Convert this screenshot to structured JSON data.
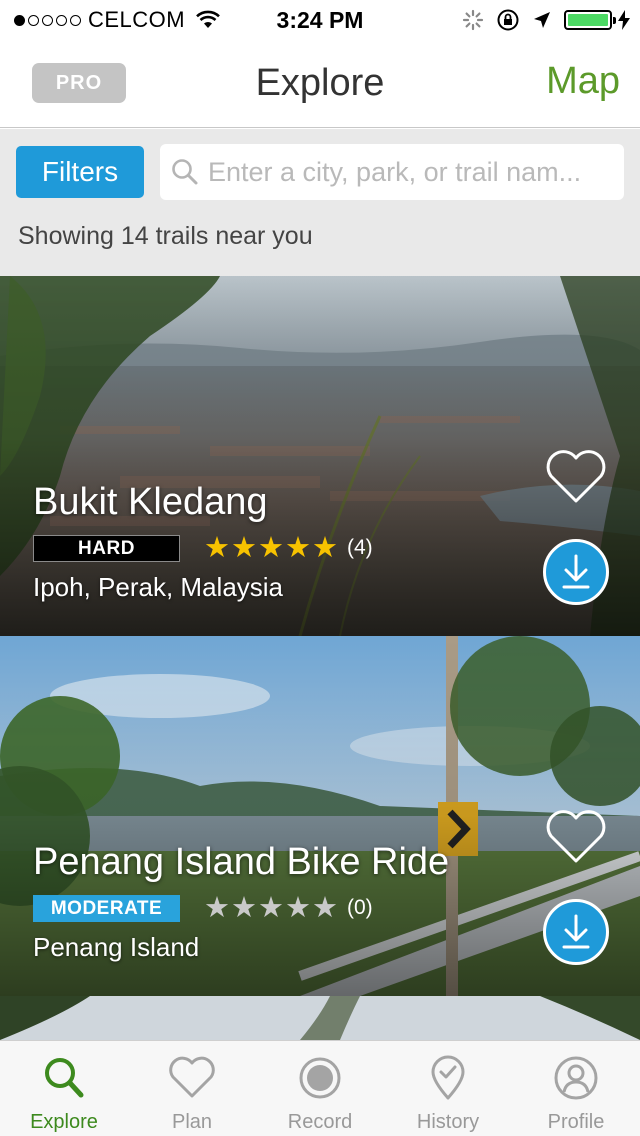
{
  "status_bar": {
    "carrier": "CELCOM",
    "time": "3:24 PM",
    "signal_bars_filled": 1,
    "signal_bars_total": 5,
    "battery_level": 1.0
  },
  "header": {
    "pro_label": "PRO",
    "title": "Explore",
    "map_label": "Map"
  },
  "search": {
    "filters_label": "Filters",
    "placeholder": "Enter a city, park, or trail nam...",
    "value": "",
    "result_count": "Showing 14 trails near you"
  },
  "trails": [
    {
      "name": "Bukit Kledang",
      "difficulty": "HARD",
      "rating": 5,
      "rating_max": 5,
      "reviews": "(4)",
      "location": "Ipoh, Perak, Malaysia"
    },
    {
      "name": "Penang Island Bike Ride",
      "difficulty": "MODERATE",
      "rating": 0,
      "rating_max": 5,
      "reviews": "(0)",
      "location": "Penang Island"
    }
  ],
  "tabs": [
    {
      "label": "Explore",
      "icon": "search-icon",
      "active": true
    },
    {
      "label": "Plan",
      "icon": "heart-icon",
      "active": false
    },
    {
      "label": "Record",
      "icon": "record-icon",
      "active": false
    },
    {
      "label": "History",
      "icon": "location-check-icon",
      "active": false
    },
    {
      "label": "Profile",
      "icon": "profile-icon",
      "active": false
    }
  ],
  "colors": {
    "accent_blue": "#1f9ad9",
    "brand_green": "#5c9a2a",
    "star_gold": "#f7c200",
    "hard_badge": "#000000",
    "moderate_badge": "#29a3dc"
  }
}
